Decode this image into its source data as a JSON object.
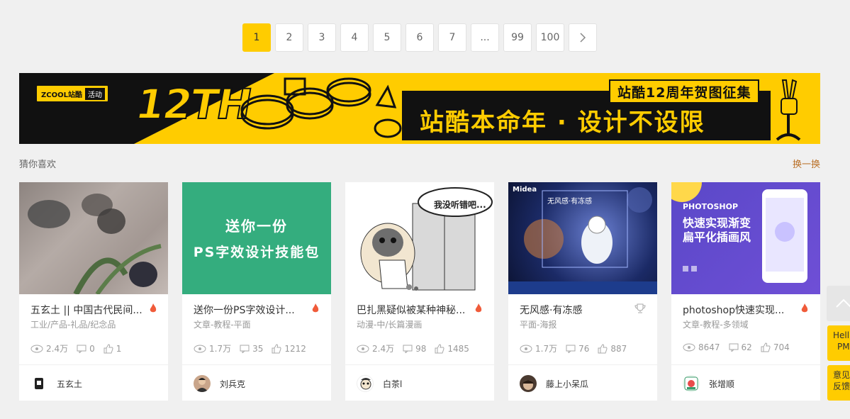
{
  "pagination": {
    "pages": [
      "1",
      "2",
      "3",
      "4",
      "5",
      "6",
      "7",
      "...",
      "99",
      "100"
    ],
    "active": "1",
    "next_icon": "chevron-right-icon"
  },
  "banner": {
    "badge_logo": "ZCOOL站酷",
    "badge_tag": "活动",
    "big_text": "12TH",
    "subtitle": "站酷12周年贺图征集",
    "headline": "站酷本命年 · 设计不设限",
    "colors": {
      "yellow": "#ffcc00",
      "black": "#111111"
    }
  },
  "section": {
    "title": "猜你喜欢",
    "refresh_label": "换一换"
  },
  "cards": [
    {
      "title": "五玄土 || 中国古代民间...",
      "category": "工业/产品-礼品/纪念品",
      "views": "2.4万",
      "comments": "0",
      "likes": "1",
      "author": "五玄土",
      "badge_icon": "hot-icon"
    },
    {
      "title": "送你一份PS字效设计...",
      "category": "文章-教程-平面",
      "views": "1.7万",
      "comments": "35",
      "likes": "1212",
      "author": "刘兵克",
      "badge_icon": "hot-icon",
      "thumb_line1": "送你一份",
      "thumb_line2": "PS字效设计技能包"
    },
    {
      "title": "巴扎黑疑似被某种神秘...",
      "category": "动漫-中/长篇漫画",
      "views": "2.4万",
      "comments": "98",
      "likes": "1485",
      "author": "白茶l",
      "badge_icon": "hot-icon",
      "thumb_bubble": "我没听错吧..."
    },
    {
      "title": "无风感·有冻感",
      "category": "平面-海报",
      "views": "1.7万",
      "comments": "76",
      "likes": "887",
      "author": "藤上小呆瓜",
      "badge_icon": "trophy-icon",
      "thumb_brand": "Midea",
      "thumb_text": "无风感·有冻感"
    },
    {
      "title": "photoshop快速实现...",
      "category": "文章-教程-多领域",
      "views": "8647",
      "comments": "62",
      "likes": "704",
      "author": "张增顺",
      "badge_icon": "hot-icon",
      "thumb_en": "PHOTOSHOP",
      "thumb_cn1": "快速实现渐变",
      "thumb_cn2": "扁平化插画风"
    }
  ],
  "side": {
    "hello": "Hell",
    "hello2": "PM",
    "feedback": "意见",
    "feedback2": "反馈"
  }
}
